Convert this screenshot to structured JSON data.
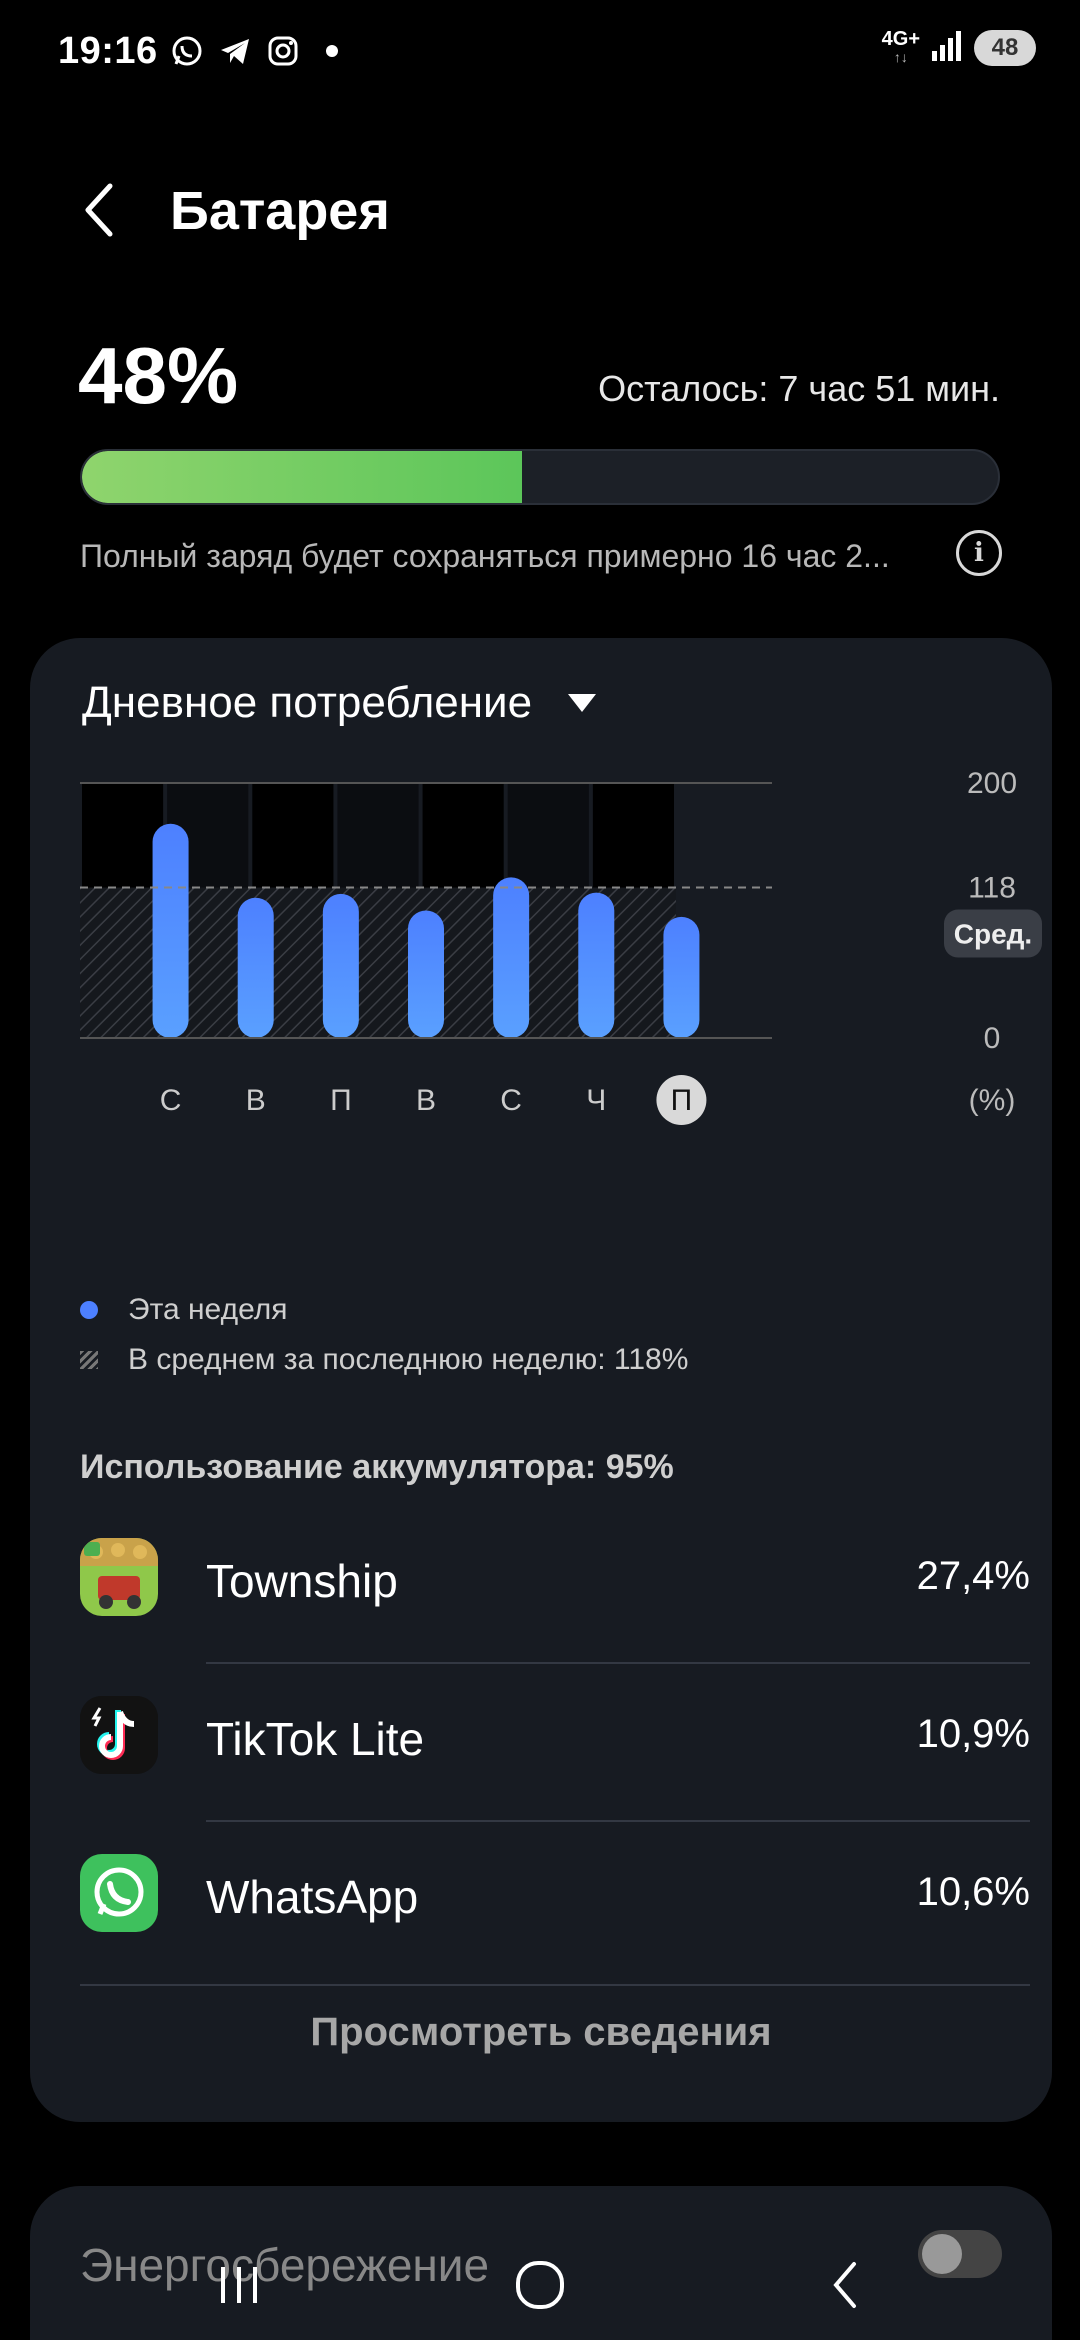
{
  "status_bar": {
    "time": "19:16",
    "network_type": "4G+",
    "network_arrows": "↑↓",
    "battery_level": "48"
  },
  "header": {
    "title": "Батарея"
  },
  "battery": {
    "percent": "48%",
    "level_fraction": 0.48,
    "remaining": "Осталось: 7 час 51 мин.",
    "full_charge_note": "Полный заряд будет сохраняться примерно 16 час 2...",
    "fill_colors": [
      "#8fd46d",
      "#5cc65a"
    ]
  },
  "daily_usage": {
    "dropdown_label": "Дневное потребление",
    "legend": {
      "this_week": "Эта неделя",
      "average": "В среднем за последнюю неделю: 118%"
    },
    "usage_total": "Использование аккумулятора: 95%",
    "apps": [
      {
        "name": "Township",
        "percent": "27,4%",
        "icon": "township-icon"
      },
      {
        "name": "TikTok Lite",
        "percent": "10,9%",
        "icon": "tiktok-icon"
      },
      {
        "name": "WhatsApp",
        "percent": "10,6%",
        "icon": "whatsapp-icon"
      }
    ],
    "details_button": "Просмотреть сведения"
  },
  "chart_data": {
    "type": "bar",
    "categories": [
      "С",
      "В",
      "П",
      "В",
      "С",
      "Ч",
      "П"
    ],
    "values": [
      168,
      110,
      113,
      100,
      126,
      114,
      95
    ],
    "average": 118,
    "average_label": "Сред.",
    "highlighted_index": 6,
    "y_ticks": [
      "200",
      "118",
      "0"
    ],
    "y_unit_label": "(%)",
    "ylim": [
      0,
      200
    ],
    "bar_color": "#4d80ff"
  },
  "next_section": {
    "label": "Энергосбережение"
  }
}
